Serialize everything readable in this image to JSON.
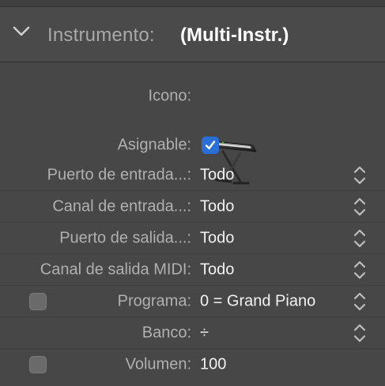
{
  "header": {
    "label": "Instrumento:",
    "value": "(Multi-Instr.)",
    "expanded": true
  },
  "fields": {
    "icon": {
      "label": "Icono:",
      "icon": "keyboard-stand-icon"
    },
    "assignable": {
      "label": "Asignable:",
      "checked": true
    },
    "input_port": {
      "label": "Puerto de entrada...:",
      "value": "Todo"
    },
    "input_channel": {
      "label": "Canal de entrada...:",
      "value": "Todo"
    },
    "output_port": {
      "label": "Puerto de salida...:",
      "value": "Todo"
    },
    "output_channel": {
      "label": "Canal de salida MIDI:",
      "value": "Todo"
    },
    "program": {
      "label": "Programa:",
      "value": "0 = Grand Piano",
      "enabled": false
    },
    "bank": {
      "label": "Banco:",
      "value": "÷"
    },
    "volume": {
      "label": "Volumen:",
      "value": "100",
      "enabled": false
    }
  },
  "colors": {
    "background": "#474747",
    "label_text": "#b0b0b0",
    "value_text": "#f2f2f2",
    "checkbox_accent": "#2a6fd8"
  }
}
